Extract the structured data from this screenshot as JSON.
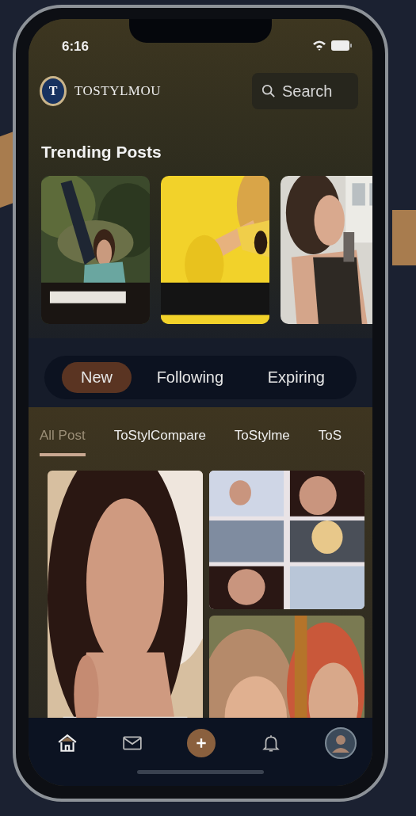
{
  "status_bar": {
    "time": "6:16"
  },
  "header": {
    "logo_letter": "T",
    "brand": "TOSTYLMOU",
    "search": {
      "placeholder": "Search"
    }
  },
  "trending": {
    "title": "Trending Posts"
  },
  "feed_tabs": [
    {
      "label": "New",
      "selected": true
    },
    {
      "label": "Following",
      "selected": false
    },
    {
      "label": "Expiring",
      "selected": false
    }
  ],
  "category_tabs": [
    {
      "label": "All Post",
      "selected": true
    },
    {
      "label": "ToStylCompare",
      "selected": false
    },
    {
      "label": "ToStylme",
      "selected": false
    },
    {
      "label": "ToS",
      "selected": false
    }
  ],
  "bottom_nav": [
    {
      "selected": true
    },
    {
      "selected": false
    },
    {
      "selected": false
    },
    {
      "selected": false
    },
    {
      "selected": false
    }
  ]
}
